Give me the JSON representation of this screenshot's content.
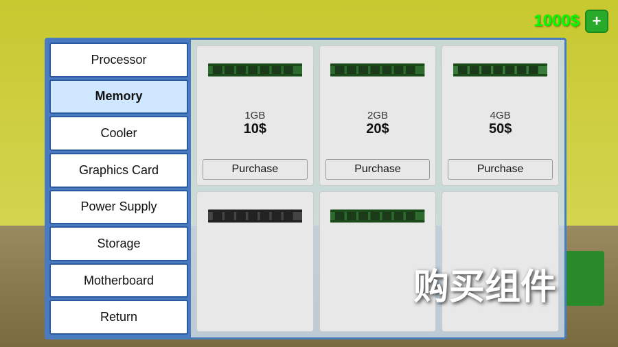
{
  "currency": {
    "amount": "1000$",
    "plus_label": "+"
  },
  "sidebar": {
    "items": [
      {
        "id": "processor",
        "label": "Processor",
        "active": false
      },
      {
        "id": "memory",
        "label": "Memory",
        "active": true
      },
      {
        "id": "cooler",
        "label": "Cooler",
        "active": false
      },
      {
        "id": "graphics-card",
        "label": "Graphics Card",
        "active": false
      },
      {
        "id": "power-supply",
        "label": "Power Supply",
        "active": false
      },
      {
        "id": "storage",
        "label": "Storage",
        "active": false
      },
      {
        "id": "motherboard",
        "label": "Motherboard",
        "active": false
      },
      {
        "id": "return",
        "label": "Return",
        "active": false
      }
    ]
  },
  "products": {
    "top_row": [
      {
        "id": "mem-1gb",
        "size": "1GB",
        "price": "10$",
        "purchase_label": "Purchase",
        "ram_color": "green"
      },
      {
        "id": "mem-2gb",
        "size": "2GB",
        "price": "20$",
        "purchase_label": "Purchase",
        "ram_color": "green"
      },
      {
        "id": "mem-4gb",
        "size": "4GB",
        "price": "50$",
        "purchase_label": "Purchase",
        "ram_color": "green"
      }
    ],
    "bottom_row": [
      {
        "id": "mem-8gb",
        "size": "",
        "price": "",
        "purchase_label": "",
        "ram_color": "dark"
      },
      {
        "id": "mem-16gb",
        "size": "",
        "price": "",
        "purchase_label": "",
        "ram_color": "green"
      },
      {
        "id": "mem-32gb",
        "size": "",
        "price": "",
        "purchase_label": "",
        "ram_color": "none"
      }
    ]
  },
  "overlay": {
    "text": "购买组件"
  }
}
